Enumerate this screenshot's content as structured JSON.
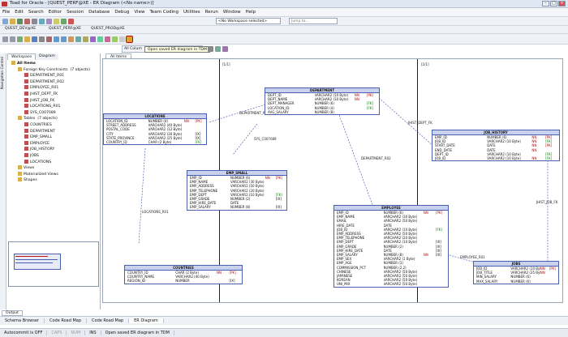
{
  "window": {
    "title": "Toad for Oracle - [QUEST_PERF@XE - ER Diagram (<No name>)]"
  },
  "menu": [
    "File",
    "Edit",
    "Search",
    "Editor",
    "Session",
    "Database",
    "Debug",
    "View",
    "Team Coding",
    "Utilities",
    "Rerun",
    "Window",
    "Help"
  ],
  "toolbar": {
    "workspace_select": "<No Workspace selected>",
    "jump_placeholder": "Jump to...",
    "connections": [
      "QUEST_DEV@XE",
      "QUEST_PERF@XE",
      "QUEST_PROD@XE"
    ],
    "all_columns": "All Colum",
    "tooltip": "Open saved ER diagram in TDM"
  },
  "sidebar": {
    "tabs": [
      "Workspace",
      "Diagram"
    ],
    "vertical_label": "Navigation Control",
    "tree": [
      {
        "level": 0,
        "label": "All Items"
      },
      {
        "level": 1,
        "label": "Foreign Key Constraints",
        "count": "(7 objects)"
      },
      {
        "level": 2,
        "label": "DEPARTMENT_R01"
      },
      {
        "level": 2,
        "label": "DEPARTMENT_R02"
      },
      {
        "level": 2,
        "label": "EMPLOYEE_R01"
      },
      {
        "level": 2,
        "label": "JHIST_DEPT_FK"
      },
      {
        "level": 2,
        "label": "JHIST_JOB_FK"
      },
      {
        "level": 2,
        "label": "LOCATIONS_R01"
      },
      {
        "level": 2,
        "label": "SYS_C007089"
      },
      {
        "level": 1,
        "label": "Tables",
        "count": "(7 objects)"
      },
      {
        "level": 2,
        "label": "COUNTRIES"
      },
      {
        "level": 2,
        "label": "DEPARTMENT"
      },
      {
        "level": 2,
        "label": "EMP_SMALL"
      },
      {
        "level": 2,
        "label": "EMPLOYEE"
      },
      {
        "level": 2,
        "label": "JOB_HISTORY"
      },
      {
        "level": 2,
        "label": "JOBS"
      },
      {
        "level": 2,
        "label": "LOCATIONS"
      },
      {
        "level": 1,
        "label": "Views"
      },
      {
        "level": 1,
        "label": "Materialized Views"
      },
      {
        "level": 1,
        "label": "Shapes"
      }
    ]
  },
  "diagram": {
    "tab": "All Items",
    "marks": [
      "[1/1]",
      "[2/1]"
    ],
    "entities": {
      "department": {
        "title": "DEPARTMENT",
        "rows": [
          [
            "DEPT_ID",
            "VARCHAR2 (10 Byte)",
            "NN",
            "[PK]"
          ],
          [
            "DEPT_NAME",
            "VARCHAR2 (30 Byte)",
            "NN",
            ""
          ],
          [
            "DEPT_MANAGER",
            "NUMBER (6)",
            "",
            "[FK]"
          ],
          [
            "LOCATION_ID",
            "NUMBER (4)",
            "",
            "[FK]"
          ],
          [
            "AVG_SALARY",
            "NUMBER (8)",
            "",
            ""
          ]
        ]
      },
      "locations": {
        "title": "LOCATIONS",
        "rows": [
          [
            "LOCATION_ID",
            "NUMBER (4)",
            "NN",
            "[PK]"
          ],
          [
            "STREET_ADDRESS",
            "VARCHAR2 (40 Byte)",
            "",
            ""
          ],
          [
            "POSTAL_CODE",
            "VARCHAR2 (12 Byte)",
            "",
            ""
          ],
          [
            "CITY",
            "VARCHAR2 (30 Byte)",
            "",
            "[IX]"
          ],
          [
            "STATE_PROVINCE",
            "VARCHAR2 (25 Byte)",
            "",
            "[IX]"
          ],
          [
            "COUNTRY_ID",
            "CHAR (2 Byte)",
            "",
            "[FK]"
          ]
        ]
      },
      "job_history": {
        "title": "JOB_HISTORY",
        "rows": [
          [
            "EMP_ID",
            "NUMBER (6)",
            "NN",
            "[PK]"
          ],
          [
            "JOB_ID",
            "VARCHAR2 (10 Byte)",
            "NN",
            "[FK]"
          ],
          [
            "START_DATE",
            "DATE",
            "NN",
            "[PK]"
          ],
          [
            "END_DATE",
            "DATE",
            "NN",
            ""
          ],
          [
            "DEPT_ID",
            "VARCHAR2 (10 Byte)",
            "",
            "[FK]"
          ],
          [
            "JOB_ID",
            "VARCHAR2 (10 Byte)",
            "NN",
            "[FK]"
          ]
        ]
      },
      "emp_small": {
        "title": "EMP_SMALL",
        "rows": [
          [
            "EMP_ID",
            "NUMBER (6)",
            "NN",
            "[PK]"
          ],
          [
            "EMP_NAME",
            "VARCHAR2 (30 Byte)",
            "",
            ""
          ],
          [
            "EMP_ADDRESS",
            "VARCHAR2 (50 Byte)",
            "",
            ""
          ],
          [
            "EMP_TELEPHONE",
            "VARCHAR2 (20 Byte)",
            "",
            ""
          ],
          [
            "EMP_DEPT",
            "VARCHAR2 (10 Byte)",
            "",
            "[FK]"
          ],
          [
            "EMP_GRADE",
            "NUMBER (2)",
            "",
            "[IX]"
          ],
          [
            "EMP_HIRE_DATE",
            "DATE",
            "",
            ""
          ],
          [
            "EMP_SALARY",
            "NUMBER (8)",
            "",
            "[IX]"
          ]
        ]
      },
      "employee": {
        "title": "EMPLOYEE",
        "rows": [
          [
            "EMP_ID",
            "NUMBER (6)",
            "NN",
            "[PK]"
          ],
          [
            "EMP_NAME",
            "VARCHAR2 (30 Byte)",
            "",
            ""
          ],
          [
            "EMAIL",
            "VARCHAR2 (50 Byte)",
            "",
            ""
          ],
          [
            "HIRE_DATE",
            "DATE",
            "",
            ""
          ],
          [
            "JOB_ID",
            "VARCHAR2 (10 Byte)",
            "",
            "[FK]"
          ],
          [
            "EMP_ADDRESS",
            "VARCHAR2 (50 Byte)",
            "",
            ""
          ],
          [
            "EMP_TELEPHONE",
            "VARCHAR2 (20 Byte)",
            "",
            ""
          ],
          [
            "EMP_DEPT",
            "VARCHAR2 (10 Byte)",
            "",
            "[IX]"
          ],
          [
            "EMP_GRADE",
            "NUMBER (2)",
            "",
            "[IX]"
          ],
          [
            "EMP_HIRE_DATE",
            "DATE",
            "",
            "[IX]"
          ],
          [
            "EMP_SALARY",
            "NUMBER (8)",
            "NN",
            "[IX]"
          ],
          [
            "EMP_SEX",
            "VARCHAR2 (1 Byte)",
            "",
            ""
          ],
          [
            "EMP_AGE",
            "NUMBER (3)",
            "",
            ""
          ],
          [
            "COMMISSION_PCT",
            "NUMBER (2,2)",
            "",
            ""
          ],
          [
            "CHINESE",
            "VARCHAR2 (50 Byte)",
            "",
            ""
          ],
          [
            "JAPANESE",
            "VARCHAR2 (50 Byte)",
            "",
            ""
          ],
          [
            "KOREAN",
            "VARCHAR2 (50 Byte)",
            "",
            ""
          ],
          [
            "UNI_MIX",
            "VARCHAR2 (50 Byte)",
            "",
            ""
          ]
        ]
      },
      "countries": {
        "title": "COUNTRIES",
        "rows": [
          [
            "COUNTRY_ID",
            "CHAR (2 Byte)",
            "NN",
            "[PK]"
          ],
          [
            "COUNTRY_NAME",
            "VARCHAR2 (40 Byte)",
            "",
            ""
          ],
          [
            "REGION_ID",
            "NUMBER",
            "",
            "[IX]"
          ]
        ]
      },
      "jobs": {
        "title": "JOBS",
        "rows": [
          [
            "JOB_ID",
            "VARCHAR2 (10 Byte)",
            "NN",
            "[PK]"
          ],
          [
            "JOB_TITLE",
            "VARCHAR2 (35 Byte)",
            "NN",
            ""
          ],
          [
            "MIN_SALARY",
            "NUMBER (6)",
            "",
            ""
          ],
          [
            "MAX_SALARY",
            "NUMBER (6)",
            "",
            ""
          ]
        ]
      }
    },
    "relations": [
      "DEPARTMENT_R01",
      "SYS_C007089",
      "JHIST_DEPT_FK",
      "DEPARTMENT_R02",
      "LOCATIONS_R01",
      "JHIST_JOB_FK",
      "EMPLOYEE_R01"
    ]
  },
  "bottom_tabs": [
    "Schema Browser",
    "Code Road Map",
    "Code Road Map",
    "ER Diagram"
  ],
  "output_tab": "Output",
  "status": [
    "Autocommit is OFF",
    "CAPS",
    "NUM",
    "INS",
    "Open saved ER diagram in TDM"
  ]
}
